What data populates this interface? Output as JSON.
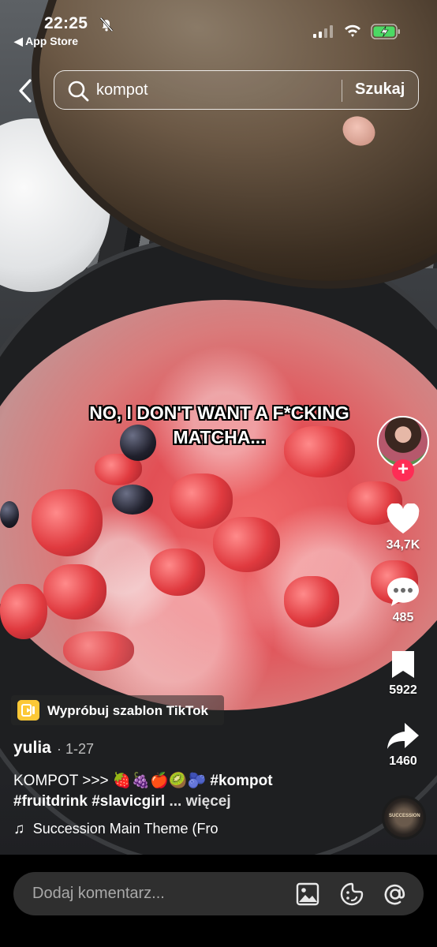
{
  "status_bar": {
    "time": "22:25",
    "back_app": "◀ App Store",
    "icons": [
      "bell-slash-icon",
      "signal-icon",
      "wifi-icon",
      "battery-charging-icon"
    ]
  },
  "search": {
    "query": "kompot",
    "button_label": "Szukaj"
  },
  "video": {
    "caption_line1": "NO, I DON'T WANT A F*CKING",
    "caption_line2": "MATCHA..."
  },
  "sidebar": {
    "follow_label": "+",
    "likes": "34,7K",
    "comments": "485",
    "saves": "5922",
    "shares": "1460",
    "music_disc_text": "SUCCESSION"
  },
  "template_chip": {
    "label": "Wypróbuj szablon TikTok"
  },
  "post": {
    "username": "yulia",
    "date": "· 1-27",
    "description_text": "KOMPOT >>> 🍓🍇🍎🥝🫐",
    "hashtag_1": "#kompot",
    "hashtag_line": "#fruitdrink #slavicgirl",
    "more_label": "... więcej",
    "music": "Succession Main Theme (Fro"
  },
  "comment_bar": {
    "placeholder": "Dodaj komentarz...",
    "icons": [
      "image-icon",
      "emoji-sticker-icon",
      "mention-icon"
    ]
  }
}
